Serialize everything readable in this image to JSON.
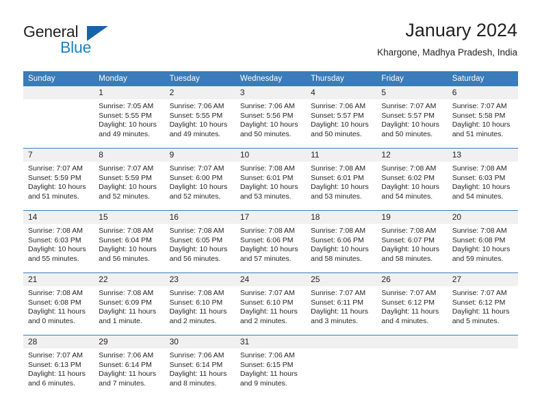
{
  "brand": {
    "name_part1": "General",
    "name_part2": "Blue",
    "logo_icon": "triangle-logo-icon"
  },
  "header": {
    "month_title": "January 2024",
    "location": "Khargone, Madhya Pradesh, India"
  },
  "colors": {
    "header_blue": "#3a7cb9",
    "logo_blue": "#1565a8",
    "brand_text_blue": "#1e7fc1",
    "daynum_band": "#f0f0f0",
    "text": "#231f20"
  },
  "weekday_headers": [
    "Sunday",
    "Monday",
    "Tuesday",
    "Wednesday",
    "Thursday",
    "Friday",
    "Saturday"
  ],
  "weeks": [
    [
      {
        "day": "",
        "sunrise": "",
        "sunset": "",
        "daylight_line1": "",
        "daylight_line2": "",
        "empty": true
      },
      {
        "day": "1",
        "sunrise": "Sunrise: 7:05 AM",
        "sunset": "Sunset: 5:55 PM",
        "daylight_line1": "Daylight: 10 hours",
        "daylight_line2": "and 49 minutes."
      },
      {
        "day": "2",
        "sunrise": "Sunrise: 7:06 AM",
        "sunset": "Sunset: 5:55 PM",
        "daylight_line1": "Daylight: 10 hours",
        "daylight_line2": "and 49 minutes."
      },
      {
        "day": "3",
        "sunrise": "Sunrise: 7:06 AM",
        "sunset": "Sunset: 5:56 PM",
        "daylight_line1": "Daylight: 10 hours",
        "daylight_line2": "and 50 minutes."
      },
      {
        "day": "4",
        "sunrise": "Sunrise: 7:06 AM",
        "sunset": "Sunset: 5:57 PM",
        "daylight_line1": "Daylight: 10 hours",
        "daylight_line2": "and 50 minutes."
      },
      {
        "day": "5",
        "sunrise": "Sunrise: 7:07 AM",
        "sunset": "Sunset: 5:57 PM",
        "daylight_line1": "Daylight: 10 hours",
        "daylight_line2": "and 50 minutes."
      },
      {
        "day": "6",
        "sunrise": "Sunrise: 7:07 AM",
        "sunset": "Sunset: 5:58 PM",
        "daylight_line1": "Daylight: 10 hours",
        "daylight_line2": "and 51 minutes."
      }
    ],
    [
      {
        "day": "7",
        "sunrise": "Sunrise: 7:07 AM",
        "sunset": "Sunset: 5:59 PM",
        "daylight_line1": "Daylight: 10 hours",
        "daylight_line2": "and 51 minutes."
      },
      {
        "day": "8",
        "sunrise": "Sunrise: 7:07 AM",
        "sunset": "Sunset: 5:59 PM",
        "daylight_line1": "Daylight: 10 hours",
        "daylight_line2": "and 52 minutes."
      },
      {
        "day": "9",
        "sunrise": "Sunrise: 7:07 AM",
        "sunset": "Sunset: 6:00 PM",
        "daylight_line1": "Daylight: 10 hours",
        "daylight_line2": "and 52 minutes."
      },
      {
        "day": "10",
        "sunrise": "Sunrise: 7:08 AM",
        "sunset": "Sunset: 6:01 PM",
        "daylight_line1": "Daylight: 10 hours",
        "daylight_line2": "and 53 minutes."
      },
      {
        "day": "11",
        "sunrise": "Sunrise: 7:08 AM",
        "sunset": "Sunset: 6:01 PM",
        "daylight_line1": "Daylight: 10 hours",
        "daylight_line2": "and 53 minutes."
      },
      {
        "day": "12",
        "sunrise": "Sunrise: 7:08 AM",
        "sunset": "Sunset: 6:02 PM",
        "daylight_line1": "Daylight: 10 hours",
        "daylight_line2": "and 54 minutes."
      },
      {
        "day": "13",
        "sunrise": "Sunrise: 7:08 AM",
        "sunset": "Sunset: 6:03 PM",
        "daylight_line1": "Daylight: 10 hours",
        "daylight_line2": "and 54 minutes."
      }
    ],
    [
      {
        "day": "14",
        "sunrise": "Sunrise: 7:08 AM",
        "sunset": "Sunset: 6:03 PM",
        "daylight_line1": "Daylight: 10 hours",
        "daylight_line2": "and 55 minutes."
      },
      {
        "day": "15",
        "sunrise": "Sunrise: 7:08 AM",
        "sunset": "Sunset: 6:04 PM",
        "daylight_line1": "Daylight: 10 hours",
        "daylight_line2": "and 56 minutes."
      },
      {
        "day": "16",
        "sunrise": "Sunrise: 7:08 AM",
        "sunset": "Sunset: 6:05 PM",
        "daylight_line1": "Daylight: 10 hours",
        "daylight_line2": "and 56 minutes."
      },
      {
        "day": "17",
        "sunrise": "Sunrise: 7:08 AM",
        "sunset": "Sunset: 6:06 PM",
        "daylight_line1": "Daylight: 10 hours",
        "daylight_line2": "and 57 minutes."
      },
      {
        "day": "18",
        "sunrise": "Sunrise: 7:08 AM",
        "sunset": "Sunset: 6:06 PM",
        "daylight_line1": "Daylight: 10 hours",
        "daylight_line2": "and 58 minutes."
      },
      {
        "day": "19",
        "sunrise": "Sunrise: 7:08 AM",
        "sunset": "Sunset: 6:07 PM",
        "daylight_line1": "Daylight: 10 hours",
        "daylight_line2": "and 58 minutes."
      },
      {
        "day": "20",
        "sunrise": "Sunrise: 7:08 AM",
        "sunset": "Sunset: 6:08 PM",
        "daylight_line1": "Daylight: 10 hours",
        "daylight_line2": "and 59 minutes."
      }
    ],
    [
      {
        "day": "21",
        "sunrise": "Sunrise: 7:08 AM",
        "sunset": "Sunset: 6:08 PM",
        "daylight_line1": "Daylight: 11 hours",
        "daylight_line2": "and 0 minutes."
      },
      {
        "day": "22",
        "sunrise": "Sunrise: 7:08 AM",
        "sunset": "Sunset: 6:09 PM",
        "daylight_line1": "Daylight: 11 hours",
        "daylight_line2": "and 1 minute."
      },
      {
        "day": "23",
        "sunrise": "Sunrise: 7:08 AM",
        "sunset": "Sunset: 6:10 PM",
        "daylight_line1": "Daylight: 11 hours",
        "daylight_line2": "and 2 minutes."
      },
      {
        "day": "24",
        "sunrise": "Sunrise: 7:07 AM",
        "sunset": "Sunset: 6:10 PM",
        "daylight_line1": "Daylight: 11 hours",
        "daylight_line2": "and 2 minutes."
      },
      {
        "day": "25",
        "sunrise": "Sunrise: 7:07 AM",
        "sunset": "Sunset: 6:11 PM",
        "daylight_line1": "Daylight: 11 hours",
        "daylight_line2": "and 3 minutes."
      },
      {
        "day": "26",
        "sunrise": "Sunrise: 7:07 AM",
        "sunset": "Sunset: 6:12 PM",
        "daylight_line1": "Daylight: 11 hours",
        "daylight_line2": "and 4 minutes."
      },
      {
        "day": "27",
        "sunrise": "Sunrise: 7:07 AM",
        "sunset": "Sunset: 6:12 PM",
        "daylight_line1": "Daylight: 11 hours",
        "daylight_line2": "and 5 minutes."
      }
    ],
    [
      {
        "day": "28",
        "sunrise": "Sunrise: 7:07 AM",
        "sunset": "Sunset: 6:13 PM",
        "daylight_line1": "Daylight: 11 hours",
        "daylight_line2": "and 6 minutes."
      },
      {
        "day": "29",
        "sunrise": "Sunrise: 7:06 AM",
        "sunset": "Sunset: 6:14 PM",
        "daylight_line1": "Daylight: 11 hours",
        "daylight_line2": "and 7 minutes."
      },
      {
        "day": "30",
        "sunrise": "Sunrise: 7:06 AM",
        "sunset": "Sunset: 6:14 PM",
        "daylight_line1": "Daylight: 11 hours",
        "daylight_line2": "and 8 minutes."
      },
      {
        "day": "31",
        "sunrise": "Sunrise: 7:06 AM",
        "sunset": "Sunset: 6:15 PM",
        "daylight_line1": "Daylight: 11 hours",
        "daylight_line2": "and 9 minutes."
      },
      {
        "day": "",
        "sunrise": "",
        "sunset": "",
        "daylight_line1": "",
        "daylight_line2": "",
        "empty": true
      },
      {
        "day": "",
        "sunrise": "",
        "sunset": "",
        "daylight_line1": "",
        "daylight_line2": "",
        "empty": true
      },
      {
        "day": "",
        "sunrise": "",
        "sunset": "",
        "daylight_line1": "",
        "daylight_line2": "",
        "empty": true
      }
    ]
  ]
}
